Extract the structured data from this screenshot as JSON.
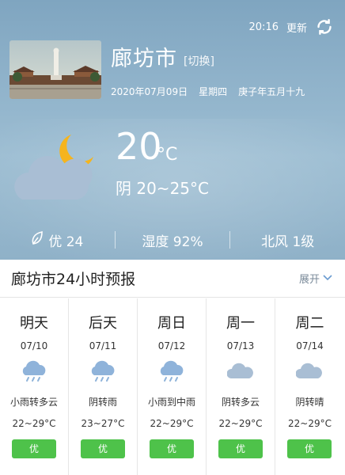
{
  "header": {
    "time": "20:16",
    "update_label": "更新",
    "refresh_icon": "refresh-icon"
  },
  "location": {
    "city": "廊坊市",
    "switch_label": "[切换]",
    "date": "2020年07月09日",
    "weekday": "星期四",
    "lunar": "庚子年五月十九"
  },
  "current": {
    "icon": "cloudy-night-icon",
    "temperature": "20",
    "unit": "°C",
    "condition_range": "阴 20~25°C"
  },
  "stats": {
    "air_quality": "优 24",
    "humidity": "湿度 92%",
    "wind": "北风 1级"
  },
  "forecast": {
    "title": "廊坊市24小时预报",
    "expand_label": "展开",
    "days": [
      {
        "name": "明天",
        "date": "07/10",
        "icon": "rain-cloud-icon",
        "condition": "小雨转多云",
        "range": "22~29°C",
        "aqi": "优"
      },
      {
        "name": "后天",
        "date": "07/11",
        "icon": "rain-cloud-icon",
        "condition": "阴转雨",
        "range": "23~27°C",
        "aqi": "优"
      },
      {
        "name": "周日",
        "date": "07/12",
        "icon": "rain-cloud-icon",
        "condition": "小雨到中雨",
        "range": "22~29°C",
        "aqi": "优"
      },
      {
        "name": "周一",
        "date": "07/13",
        "icon": "cloud-icon",
        "condition": "阴转多云",
        "range": "22~29°C",
        "aqi": "优"
      },
      {
        "name": "周二",
        "date": "07/14",
        "icon": "cloud-icon",
        "condition": "阴转晴",
        "range": "22~29°C",
        "aqi": "优"
      }
    ]
  },
  "colors": {
    "aqi_good": "#4ec24a",
    "icon_cloud": "#a9bed4",
    "icon_rain": "#8fb3da",
    "moon": "#f5b41e"
  }
}
